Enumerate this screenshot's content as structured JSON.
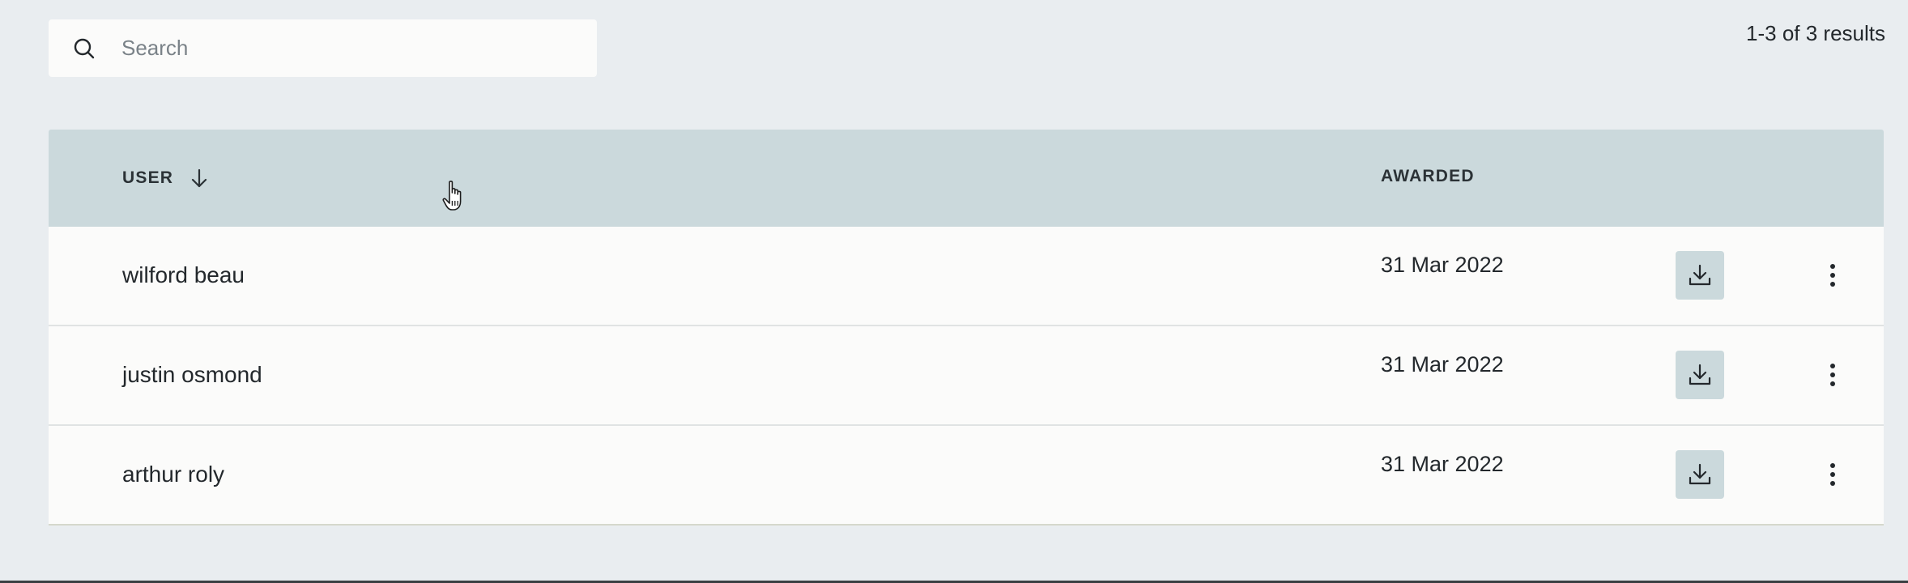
{
  "search": {
    "placeholder": "Search",
    "value": "",
    "icon": "search-icon"
  },
  "results_count": "1-3 of 3 results",
  "table": {
    "columns": [
      {
        "label": "USER",
        "sort": "descending",
        "sort_icon": "arrow-down-icon"
      },
      {
        "label": "AWARDED"
      }
    ],
    "rows": [
      {
        "user": "wilford beau",
        "awarded": "31 Mar 2022"
      },
      {
        "user": "justin osmond",
        "awarded": "31 Mar 2022"
      },
      {
        "user": "arthur roly",
        "awarded": "31 Mar 2022"
      }
    ],
    "row_actions": [
      "download-icon",
      "more-vertical-icon"
    ]
  },
  "colors": {
    "page_background": "#e9edf0",
    "header_background": "#cbd9dc",
    "row_background": "#fbfbfa",
    "action_button_background": "#cbd9dc",
    "text": "#23282c"
  }
}
